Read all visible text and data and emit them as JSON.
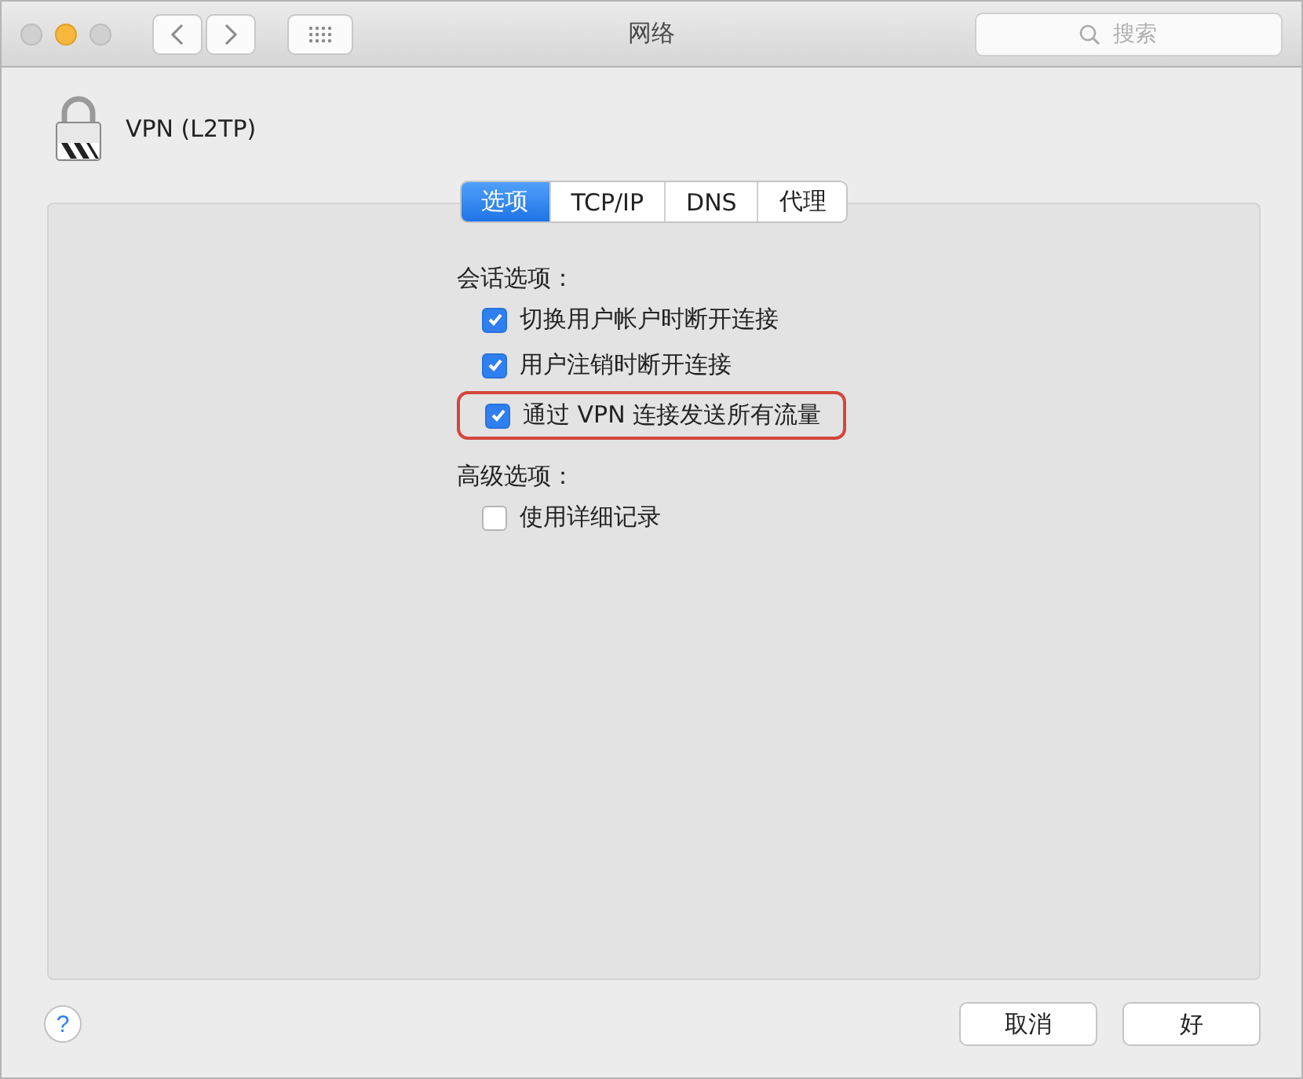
{
  "window": {
    "title": "网络"
  },
  "search": {
    "placeholder": "搜索"
  },
  "service": {
    "name": "VPN (L2TP)"
  },
  "tabs": [
    {
      "label": "选项",
      "selected": true
    },
    {
      "label": "TCP/IP",
      "selected": false
    },
    {
      "label": "DNS",
      "selected": false
    },
    {
      "label": "代理",
      "selected": false
    }
  ],
  "groups": [
    {
      "heading": "会话选项：",
      "options": [
        {
          "label": "切换用户帐户时断开连接",
          "checked": true,
          "highlighted": false
        },
        {
          "label": "用户注销时断开连接",
          "checked": true,
          "highlighted": false
        },
        {
          "label": "通过 VPN 连接发送所有流量",
          "checked": true,
          "highlighted": true
        }
      ]
    },
    {
      "heading": "高级选项：",
      "options": [
        {
          "label": "使用详细记录",
          "checked": false,
          "highlighted": false
        }
      ]
    }
  ],
  "help": {
    "label": "?"
  },
  "buttons": [
    {
      "label": "取消"
    },
    {
      "label": "好"
    }
  ]
}
